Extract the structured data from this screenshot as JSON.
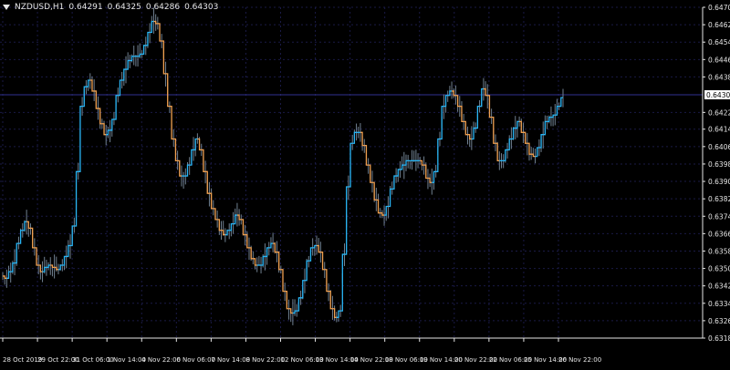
{
  "header": {
    "symbol": "NZDUSD,H1",
    "open": "0.64291",
    "high": "0.64325",
    "low": "0.64286",
    "close": "0.64303"
  },
  "colors": {
    "background": "#000000",
    "grid": "#1a1a46",
    "axis_text": "#e6e6e6",
    "price_line": "#303090",
    "candles": "#708090",
    "ma_up": "#29b6f6",
    "ma_down": "#f0a050"
  },
  "chart_data": {
    "type": "line",
    "y_axis_labels": [
      "0.64705",
      "0.64625",
      "0.64545",
      "0.64465",
      "0.64385",
      "0.64303",
      "0.64222",
      "0.64145",
      "0.64065",
      "0.63985",
      "0.63905",
      "0.63825",
      "0.63745",
      "0.63665",
      "0.63585",
      "0.63505",
      "0.63425",
      "0.63345",
      "0.63265",
      "0.63185"
    ],
    "current_price": "0.64303",
    "x_axis_labels": [
      "28 Oct 2019",
      "29 Oct 22:00",
      "31 Oct 06:00",
      "1 Nov 14:00",
      "4 Nov 22:00",
      "6 Nov 06:00",
      "7 Nov 14:00",
      "8 Nov 22:00",
      "12 Nov 06:00",
      "13 Nov 14:00",
      "14 Nov 22:00",
      "18 Nov 06:00",
      "19 Nov 14:00",
      "20 Nov 22:00",
      "22 Nov 06:00",
      "25 Nov 14:00",
      "26 Nov 22:00"
    ],
    "ylim": [
      0.63185,
      0.64705
    ],
    "series": [
      {
        "values": [
          0.6347,
          0.6346,
          0.6349,
          0.6353,
          0.6362,
          0.6368,
          0.6372,
          0.6369,
          0.636,
          0.6352,
          0.6349,
          0.6351,
          0.6352,
          0.6351,
          0.635,
          0.6352,
          0.6356,
          0.6361,
          0.637,
          0.6395,
          0.6425,
          0.6434,
          0.6437,
          0.6432,
          0.6424,
          0.6417,
          0.6412,
          0.6414,
          0.6419,
          0.643,
          0.6437,
          0.6442,
          0.6446,
          0.6448,
          0.6448,
          0.6449,
          0.6453,
          0.6459,
          0.6464,
          0.6463,
          0.6455,
          0.644,
          0.6425,
          0.641,
          0.64,
          0.6393,
          0.6393,
          0.6398,
          0.6405,
          0.641,
          0.6405,
          0.6395,
          0.6385,
          0.6378,
          0.6373,
          0.6368,
          0.6366,
          0.6368,
          0.6371,
          0.6375,
          0.6373,
          0.6366,
          0.636,
          0.6355,
          0.6352,
          0.6352,
          0.6356,
          0.636,
          0.6362,
          0.6358,
          0.635,
          0.634,
          0.6332,
          0.633,
          0.6331,
          0.6337,
          0.6345,
          0.6354,
          0.636,
          0.6361,
          0.6358,
          0.635,
          0.634,
          0.6332,
          0.6328,
          0.6331,
          0.6357,
          0.6388,
          0.6408,
          0.6413,
          0.6413,
          0.6407,
          0.6398,
          0.639,
          0.6382,
          0.6376,
          0.6375,
          0.6379,
          0.6387,
          0.6393,
          0.6396,
          0.6398,
          0.64,
          0.64,
          0.64,
          0.64,
          0.6398,
          0.6392,
          0.639,
          0.6395,
          0.641,
          0.6425,
          0.643,
          0.6432,
          0.643,
          0.6425,
          0.6418,
          0.6412,
          0.641,
          0.6415,
          0.6425,
          0.6433,
          0.643,
          0.642,
          0.6408,
          0.64,
          0.64,
          0.6405,
          0.641,
          0.6415,
          0.6418,
          0.6413,
          0.6408,
          0.6403,
          0.6402,
          0.6406,
          0.6412,
          0.6418,
          0.642,
          0.6421,
          0.6425,
          0.6429
        ]
      }
    ]
  }
}
